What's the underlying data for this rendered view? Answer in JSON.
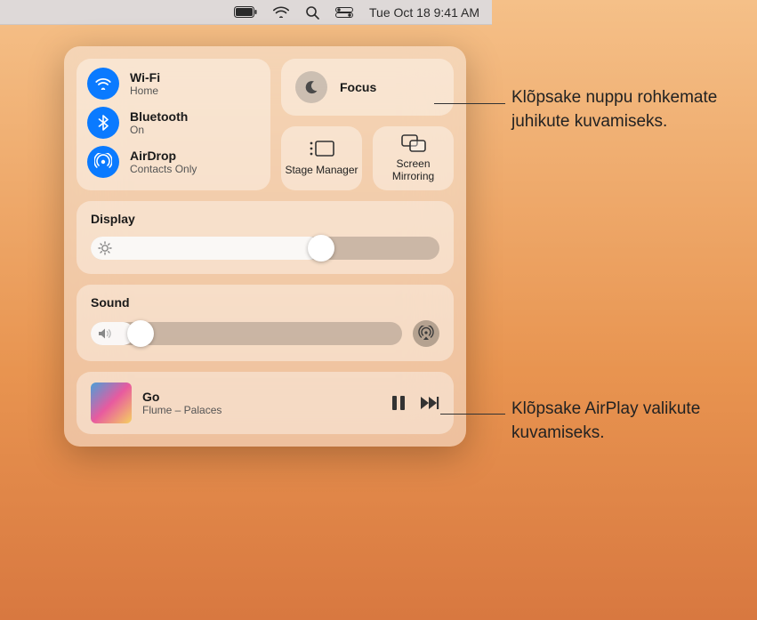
{
  "menubar": {
    "datetime": "Tue Oct 18  9:41 AM"
  },
  "conn": {
    "wifi": {
      "label": "Wi-Fi",
      "status": "Home"
    },
    "bt": {
      "label": "Bluetooth",
      "status": "On"
    },
    "ad": {
      "label": "AirDrop",
      "status": "Contacts Only"
    }
  },
  "focus": {
    "label": "Focus"
  },
  "stage": {
    "label": "Stage Manager"
  },
  "mirror": {
    "label": "Screen Mirroring"
  },
  "display": {
    "title": "Display",
    "value_pct": 66
  },
  "sound": {
    "title": "Sound",
    "value_pct": 14
  },
  "nowplaying": {
    "track": "Go",
    "artist": "Flume – Palaces"
  },
  "callouts": {
    "focus": "Klõpsake nuppu rohkemate juhikute kuvamiseks.",
    "airplay": "Klõpsake AirPlay valikute kuvamiseks."
  }
}
